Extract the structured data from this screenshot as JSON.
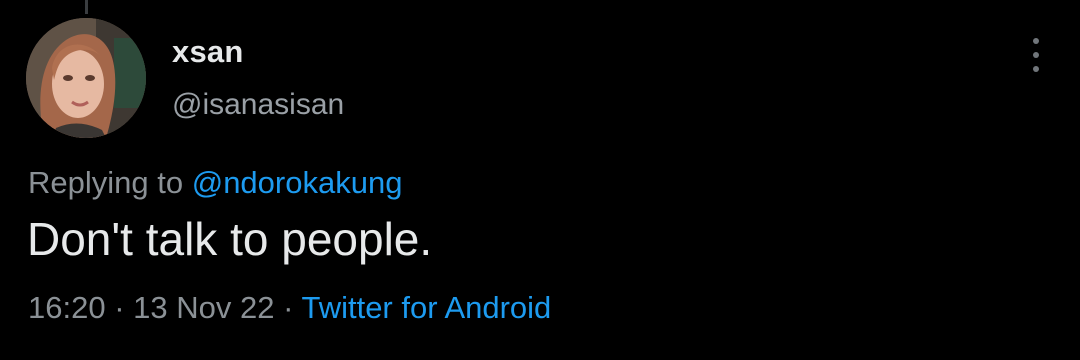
{
  "tweet": {
    "display_name": "xsan",
    "handle": "@isanasisan",
    "replying_prefix": "Replying to ",
    "replying_to": "@ndorokakung",
    "text": "Don't talk to people.",
    "time": "16:20",
    "separator_1": " · ",
    "date": "13 Nov 22",
    "separator_2": " · ",
    "source": "Twitter for Android"
  },
  "icons": {
    "avatar": "profile-photo",
    "more": "more-vertical-icon"
  },
  "colors": {
    "background": "#000000",
    "primary_text": "#e7e9ea",
    "secondary_text": "#8b9196",
    "accent": "#1d9bf0"
  }
}
